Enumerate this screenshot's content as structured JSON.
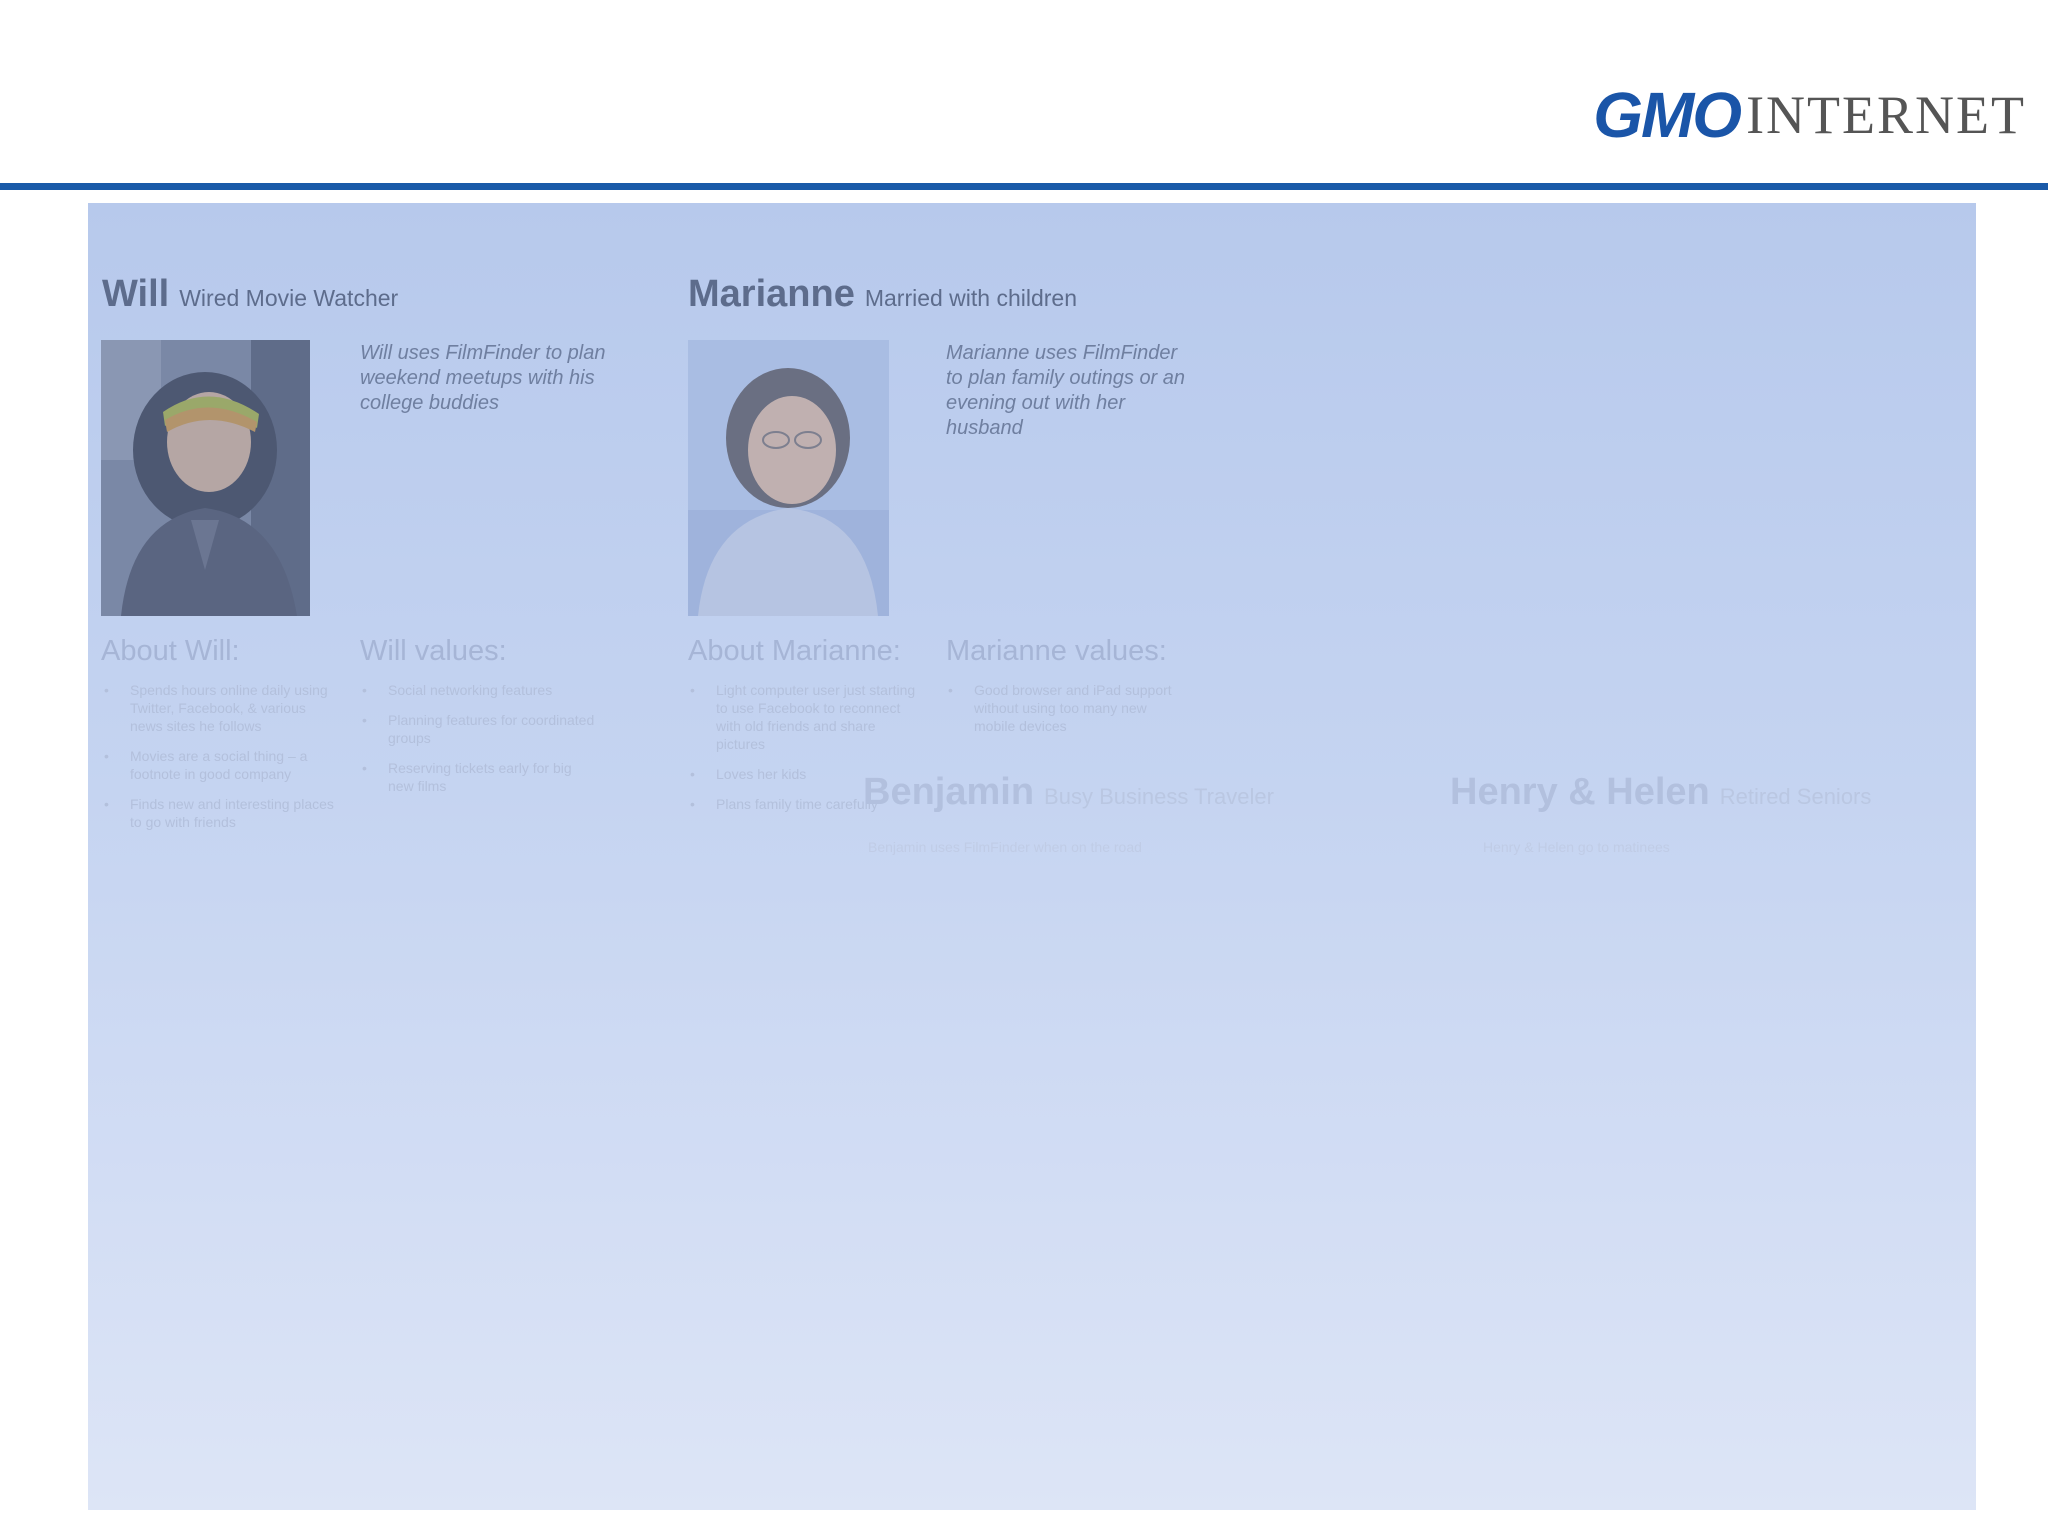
{
  "header": {
    "logo_primary": "GMO",
    "logo_secondary": "INTERNET",
    "brand_color": "#1a55a8"
  },
  "personas": {
    "will": {
      "name": "Will",
      "tagline": "Wired Movie Watcher",
      "quote": "Will uses FilmFinder to plan weekend meetups with his college buddies",
      "about_title": "About Will:",
      "about_items": [
        "Spends hours online daily using Twitter, Facebook, & various news sites he follows",
        "Movies are a social thing – a footnote in good company",
        "Finds new and interesting places to go with friends"
      ],
      "values_title": "Will values:",
      "values_items": [
        "Social networking features",
        "Planning features for coordinated groups",
        "Reserving tickets early for big new films"
      ]
    },
    "marianne": {
      "name": "Marianne",
      "tagline": "Married with children",
      "quote": "Marianne uses FilmFinder to plan family outings or an evening out with her husband",
      "about_title": "About Marianne:",
      "about_items": [
        "Light computer user just starting to use Facebook to reconnect with old friends and share pictures",
        "Loves her kids",
        "Plans family time carefully"
      ],
      "values_title": "Marianne values:",
      "values_items": [
        "Good browser and iPad support without using too many new mobile devices"
      ]
    },
    "benjamin": {
      "name": "Benjamin",
      "tagline": "Busy Business Traveler",
      "line": "Benjamin uses FilmFinder when on the road"
    },
    "henry_helen": {
      "name": "Henry & Helen",
      "tagline": "Retired Seniors",
      "line": "Henry & Helen go to matinees"
    }
  }
}
